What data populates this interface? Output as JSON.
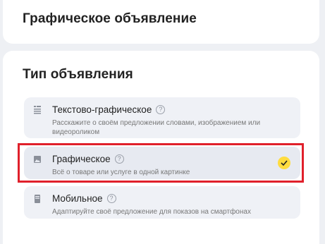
{
  "sections": {
    "ad_type_header": "Графическое объявление",
    "ad_type_title": "Тип объявления"
  },
  "options": [
    {
      "title": "Текстово-графическое",
      "description": "Расскажите о своём предложении словами, изображением или видеороликом",
      "icon": "text-graphic-icon",
      "selected": false
    },
    {
      "title": "Графическое",
      "description": "Всё о товаре или услуге в одной картинке",
      "icon": "image-icon",
      "selected": true
    },
    {
      "title": "Мобильное",
      "description": "Адаптируйте своё предложение для показов на смартфонах",
      "icon": "mobile-icon",
      "selected": false
    }
  ],
  "colors": {
    "accent": "#ffdc3f",
    "highlight": "#e0202b",
    "background": "#eef0f4"
  }
}
